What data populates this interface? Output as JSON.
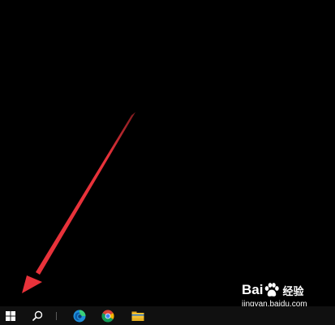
{
  "desktop": {
    "background": "#000000"
  },
  "annotation": {
    "arrow_color": "#e8323a",
    "target": "start-button"
  },
  "taskbar": {
    "background": "#101010",
    "items": [
      {
        "icon": "windows-logo-icon"
      },
      {
        "icon": "search-icon"
      },
      {
        "icon": "edge-browser-icon"
      },
      {
        "icon": "chrome-browser-icon"
      },
      {
        "icon": "file-explorer-icon"
      }
    ]
  },
  "watermark": {
    "brand_part1": "Bai",
    "brand_part2": "经验",
    "url": "jingyan.baidu.com"
  }
}
